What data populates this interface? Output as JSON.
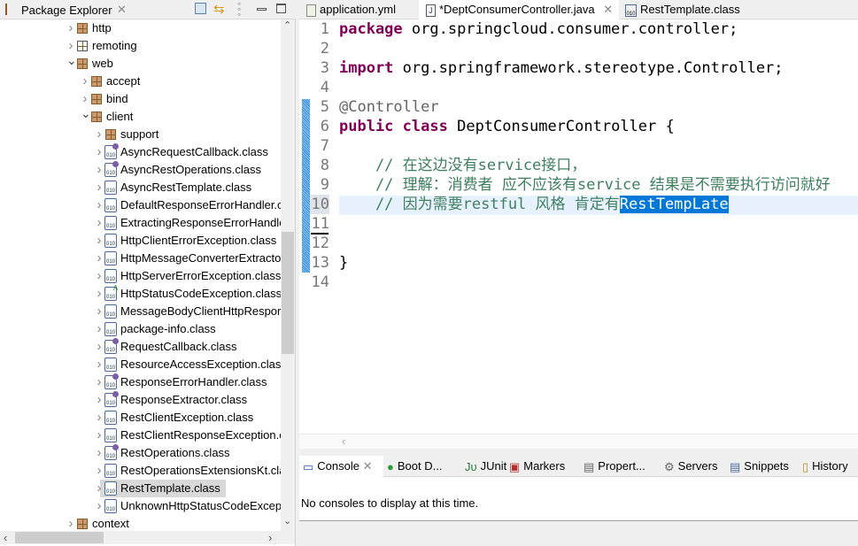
{
  "package_explorer": {
    "title": "Package Explorer",
    "items": [
      {
        "label": "http",
        "kind": "package",
        "level": 0,
        "expanded": false
      },
      {
        "label": "remoting",
        "kind": "package-empty",
        "level": 0,
        "expanded": false
      },
      {
        "label": "web",
        "kind": "package",
        "level": 0,
        "expanded": true
      },
      {
        "label": "accept",
        "kind": "package",
        "level": 1,
        "expanded": false
      },
      {
        "label": "bind",
        "kind": "package",
        "level": 1,
        "expanded": false
      },
      {
        "label": "client",
        "kind": "package",
        "level": 1,
        "expanded": true
      },
      {
        "label": "support",
        "kind": "package",
        "level": 2,
        "expanded": false
      },
      {
        "label": "AsyncRequestCallback.class",
        "kind": "interface-class",
        "level": 2
      },
      {
        "label": "AsyncRestOperations.class",
        "kind": "interface-class",
        "level": 2
      },
      {
        "label": "AsyncRestTemplate.class",
        "kind": "deprecated-class",
        "level": 2
      },
      {
        "label": "DefaultResponseErrorHandler.c",
        "kind": "class",
        "level": 2
      },
      {
        "label": "ExtractingResponseErrorHandle",
        "kind": "class",
        "level": 2
      },
      {
        "label": "HttpClientErrorException.class",
        "kind": "class",
        "level": 2
      },
      {
        "label": "HttpMessageConverterExtracto",
        "kind": "class",
        "level": 2
      },
      {
        "label": "HttpServerErrorException.class",
        "kind": "class",
        "level": 2
      },
      {
        "label": "HttpStatusCodeException.class",
        "kind": "abstract-class",
        "level": 2
      },
      {
        "label": "MessageBodyClientHttpRespor",
        "kind": "class",
        "level": 2
      },
      {
        "label": "package-info.class",
        "kind": "class",
        "level": 2
      },
      {
        "label": "RequestCallback.class",
        "kind": "interface-class",
        "level": 2
      },
      {
        "label": "ResourceAccessException.class",
        "kind": "class",
        "level": 2
      },
      {
        "label": "ResponseErrorHandler.class",
        "kind": "interface-class",
        "level": 2
      },
      {
        "label": "ResponseExtractor.class",
        "kind": "interface-class",
        "level": 2
      },
      {
        "label": "RestClientException.class",
        "kind": "class",
        "level": 2
      },
      {
        "label": "RestClientResponseException.c",
        "kind": "class",
        "level": 2
      },
      {
        "label": "RestOperations.class",
        "kind": "interface-class",
        "level": 2
      },
      {
        "label": "RestOperationsExtensionsKt.cla",
        "kind": "class",
        "level": 2
      },
      {
        "label": "RestTemplate.class",
        "kind": "class",
        "level": 2,
        "selected": true
      },
      {
        "label": "UnknownHttpStatusCodeExcept",
        "kind": "class",
        "level": 2
      },
      {
        "label": "context",
        "kind": "package",
        "level": 0,
        "expanded": false
      }
    ]
  },
  "editor": {
    "tabs": [
      {
        "label": "application.yml",
        "active": false
      },
      {
        "label": "*DeptConsumerController.java",
        "active": true
      },
      {
        "label": "RestTemplate.class",
        "active": false
      }
    ],
    "current_line": 10,
    "lines": [
      {
        "n": "1",
        "parts": [
          {
            "t": "package",
            "c": "kw"
          },
          {
            "t": " org.springcloud.consumer.controller;"
          }
        ]
      },
      {
        "n": "2",
        "parts": []
      },
      {
        "n": "3",
        "parts": [
          {
            "t": "import",
            "c": "kw"
          },
          {
            "t": " org.springframework.stereotype.Controller;"
          }
        ]
      },
      {
        "n": "4",
        "parts": []
      },
      {
        "n": "5",
        "parts": [
          {
            "t": "@Controller",
            "c": "ann"
          }
        ]
      },
      {
        "n": "6",
        "parts": [
          {
            "t": "public",
            "c": "kw"
          },
          {
            "t": " "
          },
          {
            "t": "class",
            "c": "kw"
          },
          {
            "t": " DeptConsumerController {"
          }
        ]
      },
      {
        "n": "7",
        "parts": []
      },
      {
        "n": "8",
        "parts": [
          {
            "t": "    // 在这边没有service接口，",
            "c": "cm"
          }
        ]
      },
      {
        "n": "9",
        "parts": [
          {
            "t": "    // 理解：消费者 应不应该有service 结果是不需要执行访问就好",
            "c": "cm"
          }
        ]
      },
      {
        "n": "10",
        "parts": [
          {
            "t": "    // 因为需要restful 风格 肯定有",
            "c": "cm"
          },
          {
            "t": "RestTempLate",
            "c": "selx"
          }
        ]
      },
      {
        "n": "11",
        "parts": []
      },
      {
        "n": "12",
        "parts": []
      },
      {
        "n": "13",
        "parts": [
          {
            "t": "}"
          }
        ]
      },
      {
        "n": "14",
        "parts": []
      }
    ]
  },
  "bottom": {
    "tabs": [
      {
        "label": "Console",
        "icon": "console-icon",
        "active": true
      },
      {
        "label": "Boot D...",
        "icon": "spring-boot-icon"
      },
      {
        "label": "JUnit",
        "icon": "junit-icon"
      },
      {
        "label": "Markers",
        "icon": "markers-icon"
      },
      {
        "label": "Propert...",
        "icon": "properties-icon"
      },
      {
        "label": "Servers",
        "icon": "servers-icon"
      },
      {
        "label": "Snippets",
        "icon": "snippets-icon"
      },
      {
        "label": "History",
        "icon": "history-icon"
      }
    ],
    "message": "No consoles to display at this time."
  }
}
